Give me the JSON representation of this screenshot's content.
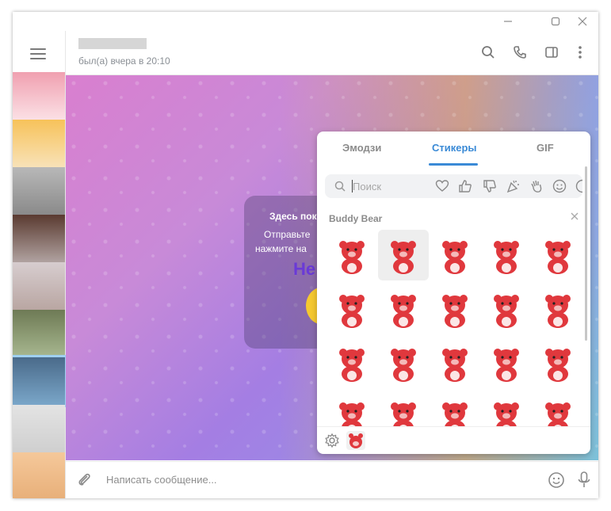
{
  "window": {
    "controls": {
      "minimize": "minimize",
      "maximize": "maximize",
      "close": "close"
    }
  },
  "header": {
    "status": "был(а) вчера в 20:10"
  },
  "placeholder": {
    "title": "Здесь пок",
    "line1": "Отправьте",
    "line2": "нажмите на",
    "hello": "He"
  },
  "composer": {
    "placeholder": "Написать сообщение..."
  },
  "sticker_panel": {
    "tabs": [
      "Эмодзи",
      "Стикеры",
      "GIF"
    ],
    "active_tab": "Стикеры",
    "search_placeholder": "Поиск",
    "pack_title": "Buddy Bear",
    "category_icons": [
      "heart-icon",
      "thumbs-up-icon",
      "thumbs-down-icon",
      "party-icon",
      "wave-hand-icon",
      "smile-icon"
    ],
    "stickers_rows": 4,
    "stickers_cols": 5,
    "selected_sticker": 1
  },
  "colors": {
    "accent": "#3a8ad6",
    "bear": "#e0383d"
  }
}
